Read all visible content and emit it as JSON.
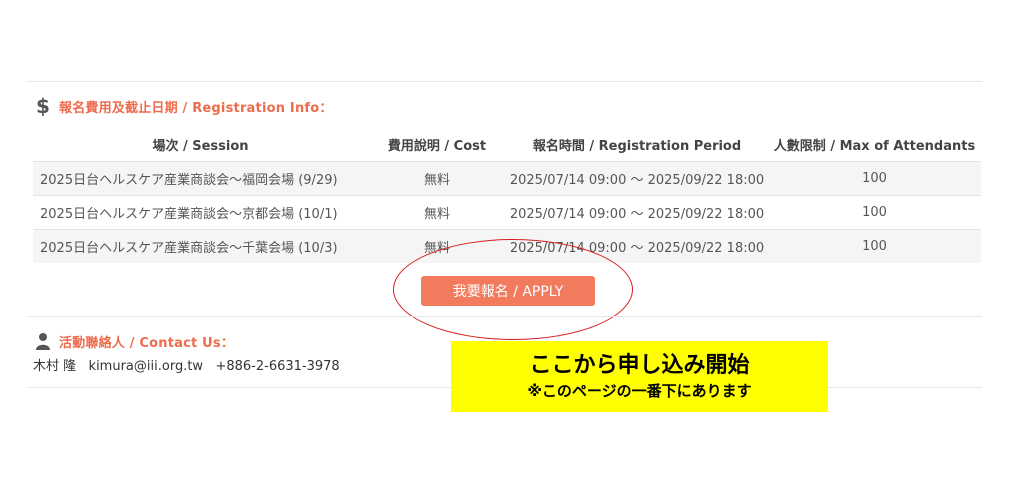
{
  "registration": {
    "heading": "報名費用及截止日期 / Registration Info：",
    "icon": "dollar-icon",
    "columns": [
      "場次 / Session",
      "費用說明 / Cost",
      "報名時間 / Registration Period",
      "人數限制 / Max of Attendants"
    ],
    "rows": [
      {
        "session": "2025日台ヘルスケア産業商談会～福岡会場 (9/29)",
        "cost": "無料",
        "period": "2025/07/14 09:00 ～ 2025/09/22 18:00",
        "max": "100"
      },
      {
        "session": "2025日台ヘルスケア産業商談会～京都会場 (10/1)",
        "cost": "無料",
        "period": "2025/07/14 09:00 ～ 2025/09/22 18:00",
        "max": "100"
      },
      {
        "session": "2025日台ヘルスケア産業商談会～千葉会場 (10/3)",
        "cost": "無料",
        "period": "2025/07/14 09:00 ～ 2025/09/22 18:00",
        "max": "100"
      }
    ],
    "apply_label": "我要報名 / APPLY"
  },
  "contact": {
    "heading": "活動聯絡人 / Contact Us：",
    "icon": "person-icon",
    "name": "木村 隆",
    "email": "kimura@iii.org.tw",
    "phone": "+886-2-6631-3978"
  },
  "annotation": {
    "line1": "ここから申し込み開始",
    "line2": "※このページの一番下にあります",
    "highlight_color": "#ffff00",
    "ellipse_color": "#d81e1e"
  },
  "colors": {
    "accent": "#ee6b4d",
    "button": "#f27b5e"
  }
}
